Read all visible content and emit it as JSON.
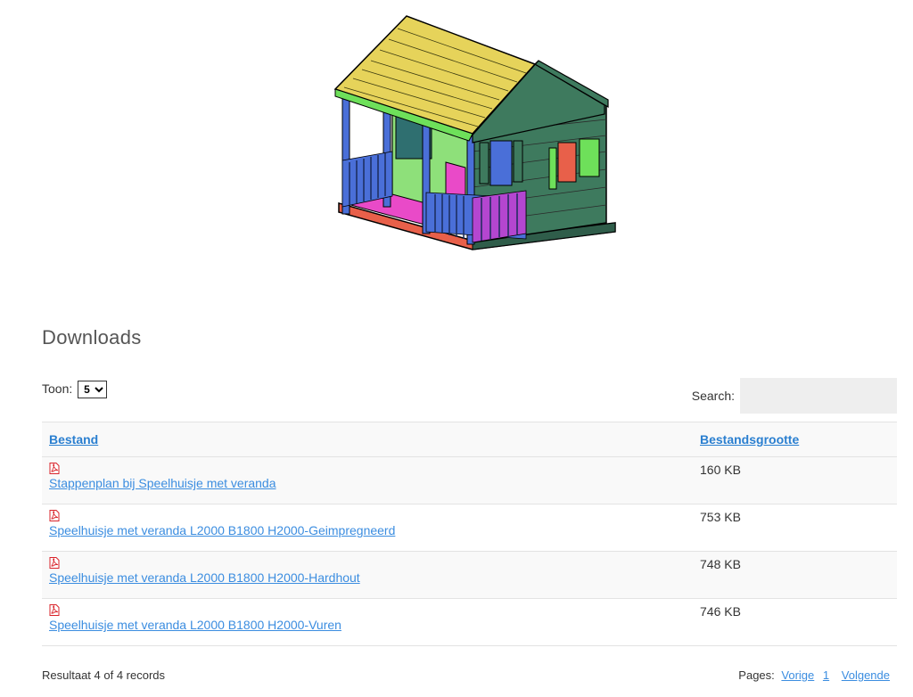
{
  "section": {
    "title": "Downloads"
  },
  "toolbar": {
    "toon_label": "Toon:",
    "page_size": "5",
    "search_label": "Search:",
    "search_value": ""
  },
  "table": {
    "headers": {
      "file": "Bestand",
      "size": "Bestandsgrootte"
    },
    "rows": [
      {
        "name": "Stappenplan bij Speelhuisje met veranda",
        "size": "160 KB",
        "icon": "pdf-icon"
      },
      {
        "name": "Speelhuisje met veranda L2000 B1800 H2000-Geimpregneerd",
        "size": "753 KB",
        "icon": "pdf-icon"
      },
      {
        "name": "Speelhuisje met veranda L2000 B1800 H2000-Hardhout",
        "size": "748 KB",
        "icon": "pdf-icon"
      },
      {
        "name": "Speelhuisje met veranda L2000 B1800 H2000-Vuren",
        "size": "746 KB",
        "icon": "pdf-icon"
      }
    ]
  },
  "footer": {
    "result_text": "Resultaat 4 of 4 records",
    "pages_label": "Pages:",
    "prev_label": "Vorige",
    "current_page": "1",
    "next_label": "Volgende"
  },
  "colors": {
    "link": "#3b8de0",
    "header_link": "#2a7fd0",
    "stripe": "#f9f9f9",
    "pdf_red": "#d9242b"
  }
}
